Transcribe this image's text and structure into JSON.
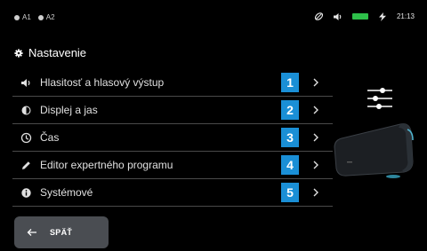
{
  "status_bar": {
    "indicators": [
      {
        "label": "A1"
      },
      {
        "label": "A2"
      }
    ],
    "time": "21:13",
    "icons": [
      "leaf-icon",
      "speaker-icon",
      "battery-icon",
      "charging-icon"
    ],
    "battery_color": "#2ec04a"
  },
  "header": {
    "title": "Nastavenie",
    "icon": "gear-icon"
  },
  "menu": {
    "items": [
      {
        "label": "Hlasitosť a hlasový výstup",
        "number": "1",
        "icon": "speaker-icon"
      },
      {
        "label": "Displej a jas",
        "number": "2",
        "icon": "brightness-icon"
      },
      {
        "label": "Čas",
        "number": "3",
        "icon": "clock-icon"
      },
      {
        "label": "Editor expertného programu",
        "number": "4",
        "icon": "pencil-icon"
      },
      {
        "label": "Systémové",
        "number": "5",
        "icon": "info-icon"
      }
    ],
    "number_badge_color": "#1a8fd6"
  },
  "footer": {
    "back_label": "SPÄŤ"
  }
}
